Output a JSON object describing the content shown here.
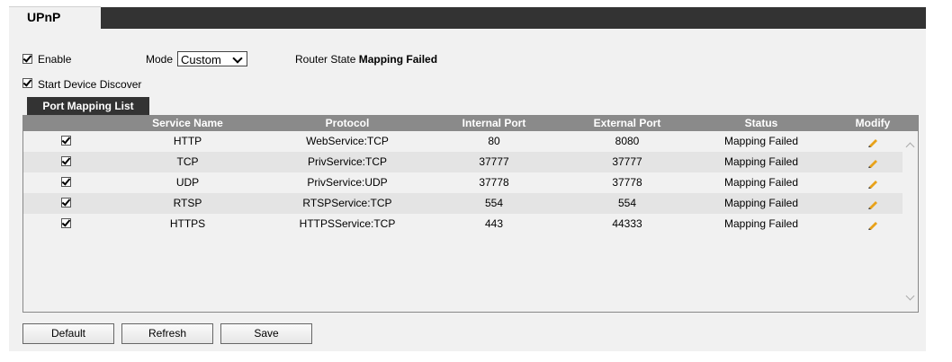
{
  "page": {
    "tab_title": "UPnP"
  },
  "settings": {
    "enable_label": "Enable",
    "enable_checked": true,
    "mode_label": "Mode",
    "mode_value": "Custom",
    "router_state_label": "Router State",
    "router_state_value": "Mapping Failed",
    "start_device_discover_label": "Start Device Discover",
    "start_device_discover_checked": true
  },
  "port_mapping": {
    "tab_label": "Port Mapping List",
    "columns": [
      "",
      "Service Name",
      "Protocol",
      "Internal Port",
      "External Port",
      "Status",
      "Modify"
    ],
    "rows": [
      {
        "checked": true,
        "service": "HTTP",
        "protocol": "WebService:TCP",
        "internal": "80",
        "external": "8080",
        "status": "Mapping Failed",
        "modify_icon": "pencil-icon"
      },
      {
        "checked": true,
        "service": "TCP",
        "protocol": "PrivService:TCP",
        "internal": "37777",
        "external": "37777",
        "status": "Mapping Failed",
        "modify_icon": "pencil-icon"
      },
      {
        "checked": true,
        "service": "UDP",
        "protocol": "PrivService:UDP",
        "internal": "37778",
        "external": "37778",
        "status": "Mapping Failed",
        "modify_icon": "pencil-icon"
      },
      {
        "checked": true,
        "service": "RTSP",
        "protocol": "RTSPService:TCP",
        "internal": "554",
        "external": "554",
        "status": "Mapping Failed",
        "modify_icon": "pencil-icon"
      },
      {
        "checked": true,
        "service": "HTTPS",
        "protocol": "HTTPSService:TCP",
        "internal": "443",
        "external": "44333",
        "status": "Mapping Failed",
        "modify_icon": "pencil-icon"
      }
    ]
  },
  "buttons": {
    "default_label": "Default",
    "refresh_label": "Refresh",
    "save_label": "Save"
  },
  "colors": {
    "header_dark": "#333333",
    "table_header": "#8a8a8a",
    "panel_bg": "#f1f1f1",
    "alt_row": "#e4e4e4",
    "pencil": "#e8a21a"
  }
}
